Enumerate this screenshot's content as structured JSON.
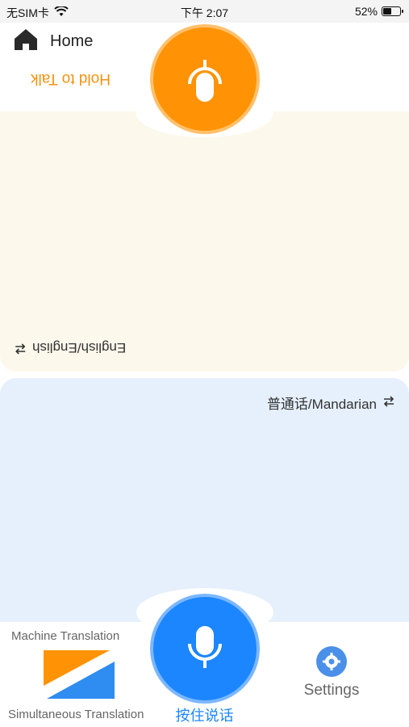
{
  "status_bar": {
    "carrier": "无SIM卡",
    "time": "下午 2:07",
    "battery": "52%",
    "battery_level": 0.52
  },
  "header": {
    "home_label": "Home",
    "hold_to_talk": "Hold to Talk"
  },
  "top_panel": {
    "language": "English/English",
    "swap_icon": "swap-arrows-icon"
  },
  "bottom_panel": {
    "language": "普通话/Mandarian",
    "swap_icon": "swap-arrows-icon"
  },
  "bottom_bar": {
    "machine_translation": "Machine Translation",
    "simultaneous_translation": "Simultaneous Translation",
    "hold_to_talk": "按住说话",
    "settings": "Settings"
  },
  "colors": {
    "orange": "#ff9305",
    "blue": "#1b86ff",
    "top_panel_bg": "#fdf8ec",
    "bottom_panel_bg": "#e6f0fc"
  }
}
